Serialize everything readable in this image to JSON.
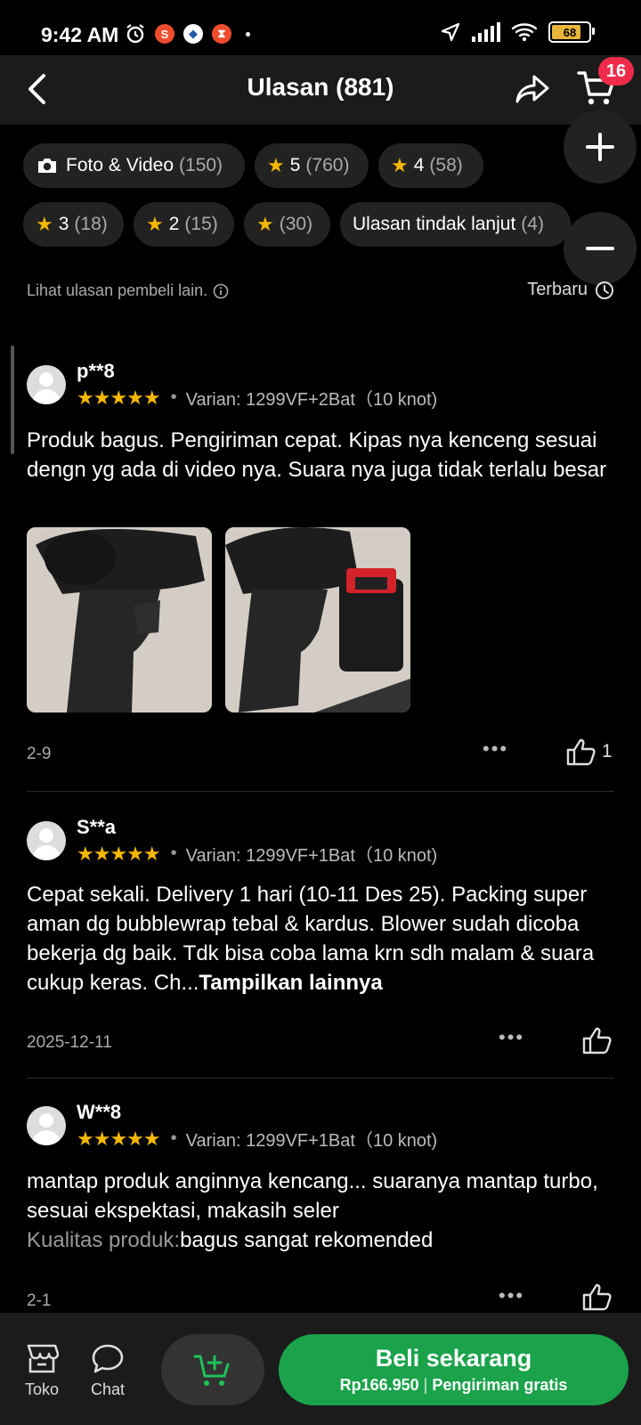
{
  "status": {
    "time": "9:42 AM",
    "battery": "68"
  },
  "header": {
    "title": "Ulasan (881)",
    "cart_badge": "16"
  },
  "filters": [
    {
      "label": "Foto & Video",
      "count": "(150)"
    },
    {
      "label": "5",
      "count": "(760)"
    },
    {
      "label": "4",
      "count": "(58)"
    },
    {
      "label": "3",
      "count": "(18)"
    },
    {
      "label": "2",
      "count": "(15)"
    },
    {
      "label": "",
      "count": "(30)"
    },
    {
      "label": "Ulasan tindak lanjut",
      "count": "(4)"
    }
  ],
  "hint": "Lihat ulasan pembeli lain.",
  "sort_label": "Terbaru",
  "reviews": [
    {
      "user": "p**8",
      "stars": "★★★★★",
      "rating": 5,
      "variant": "Varian: 1299VF+2Bat（10 knot)",
      "text": "Produk bagus. Pengiriman cepat. Kipas nya kenceng sesuai dengn yg ada di video nya. Suara nya juga tidak terlalu besar",
      "date": "2-9",
      "likes": "1"
    },
    {
      "user": "S**a",
      "stars": "★★★★★",
      "rating": 5,
      "variant": "Varian: 1299VF+1Bat（10 knot)",
      "text": "Cepat sekali. Delivery 1 hari (10-11 Des 25). Packing super aman dg bubblewrap tebal & kardus. Blower sudah dicoba bekerja dg baik. Tdk bisa coba lama krn sdh malam & suara cukup keras. Ch...",
      "more": "Tampilkan lainnya",
      "date": "2025-12-11"
    },
    {
      "user": "W**8",
      "stars": "★★★★★",
      "rating": 5,
      "variant": "Varian: 1299VF+1Bat（10 knot)",
      "text": "mantap produk anginnya kencang... suaranya mantap turbo, sesuai ekspektasi, makasih seler",
      "quality_label": "Kualitas produk:",
      "quality_value": "bagus sangat rekomended",
      "date": "2-1"
    }
  ],
  "bottom": {
    "shop": "Toko",
    "chat": "Chat",
    "buy_title": "Beli sekarang",
    "buy_price": "Rp166.950",
    "buy_shipping": "Pengiriman gratis"
  },
  "colors": {
    "accent": "#1aa34a",
    "star": "#f5b800",
    "badge": "#ee2c4a"
  }
}
